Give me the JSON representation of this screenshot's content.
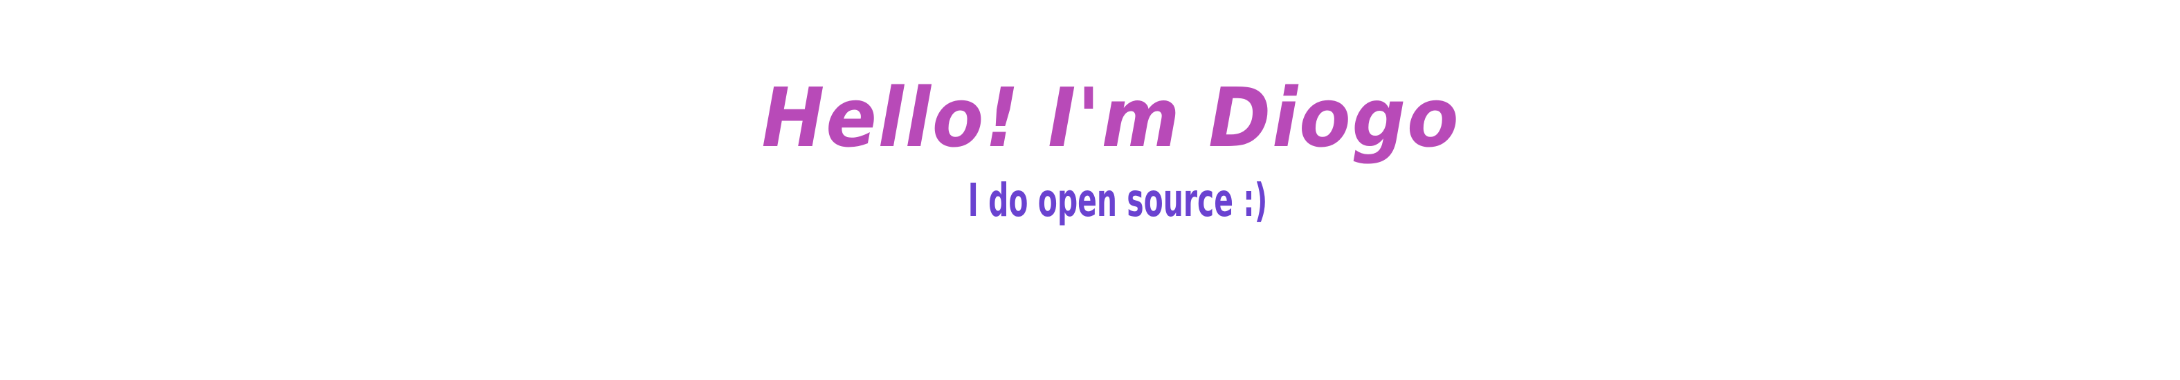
{
  "banner": {
    "title": "Hello! I'm Diogo",
    "subtitle": "I do open source :)",
    "colors": {
      "title": "#b84ab8",
      "subtitle": "#6a42d0",
      "background": "#ffffff"
    }
  }
}
